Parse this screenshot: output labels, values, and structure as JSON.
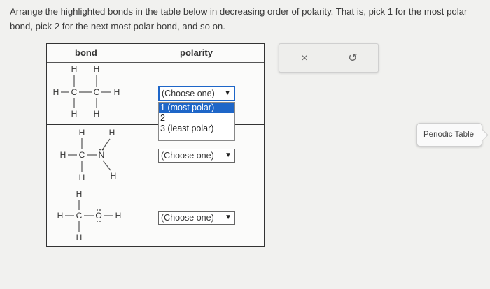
{
  "prompt": {
    "line1": "Arrange the highlighted bonds in the table below in decreasing order of polarity. That is, pick 1 for the most polar",
    "line2": "bond, pick 2 for the next most polar bond, and so on."
  },
  "table": {
    "headers": {
      "bond": "bond",
      "polarity": "polarity"
    },
    "rows": [
      {
        "molecule": "ethane",
        "atoms": {
          "top_h1": "H",
          "top_h2": "H",
          "left_h": "H",
          "c1": "C",
          "c2": "C",
          "right_h": "H",
          "bot_h1": "H",
          "bot_h2": "H"
        },
        "select": {
          "value": "(Choose one)",
          "open": true
        }
      },
      {
        "molecule": "methylamine",
        "atoms": {
          "top_h": "H",
          "nh_top": "H",
          "left_h": "H",
          "c": "C",
          "n": "N",
          "bot_h": "H",
          "nh_bot": "H"
        },
        "select": {
          "value": "(Choose one)",
          "open": false
        }
      },
      {
        "molecule": "methanol",
        "atoms": {
          "top_h": "H",
          "left_h": "H",
          "c": "C",
          "o": "O",
          "right_h": "H",
          "bot_h": "H"
        },
        "select": {
          "value": "(Choose one)",
          "open": false
        }
      }
    ],
    "dropdown_options": [
      "1 (most polar)",
      "2",
      "3 (least polar)"
    ],
    "dropdown_highlighted": "1 (most polar)"
  },
  "actions": {
    "close_icon": "×",
    "undo_icon": "↺"
  },
  "periodic_table_label": "Periodic Table"
}
